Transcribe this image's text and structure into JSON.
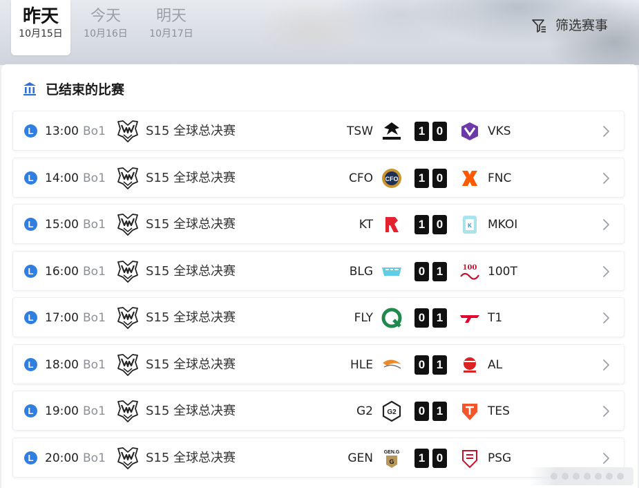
{
  "date_tabs": [
    {
      "day": "昨天",
      "date": "10月15日"
    },
    {
      "day": "今天",
      "date": "10月16日"
    },
    {
      "day": "明天",
      "date": "10月17日"
    }
  ],
  "filter": {
    "label": "筛选赛事"
  },
  "section": {
    "title": "已结束的比赛"
  },
  "colors": {
    "accent": "#2f7ee0",
    "score_bg": "#111111"
  },
  "matches": [
    {
      "badge": "L",
      "time": "13:00",
      "format": "Bo1",
      "event_icon": "worlds-trophy-icon",
      "event": "S15 全球总决赛",
      "team_a": "TSW",
      "logo_a": "tsw-logo-icon",
      "score_a": "1",
      "score_b": "0",
      "team_b": "VKS",
      "logo_b": "vks-logo-icon"
    },
    {
      "badge": "L",
      "time": "14:00",
      "format": "Bo1",
      "event_icon": "worlds-trophy-icon",
      "event": "S15 全球总决赛",
      "team_a": "CFO",
      "logo_a": "cfo-logo-icon",
      "score_a": "1",
      "score_b": "0",
      "team_b": "FNC",
      "logo_b": "fnc-logo-icon"
    },
    {
      "badge": "L",
      "time": "15:00",
      "format": "Bo1",
      "event_icon": "worlds-trophy-icon",
      "event": "S15 全球总决赛",
      "team_a": "KT",
      "logo_a": "kt-logo-icon",
      "score_a": "1",
      "score_b": "0",
      "team_b": "MKOI",
      "logo_b": "mkoi-logo-icon"
    },
    {
      "badge": "L",
      "time": "16:00",
      "format": "Bo1",
      "event_icon": "worlds-trophy-icon",
      "event": "S15 全球总决赛",
      "team_a": "BLG",
      "logo_a": "blg-logo-icon",
      "score_a": "0",
      "score_b": "1",
      "team_b": "100T",
      "logo_b": "100t-logo-icon"
    },
    {
      "badge": "L",
      "time": "17:00",
      "format": "Bo1",
      "event_icon": "worlds-trophy-icon",
      "event": "S15 全球总决赛",
      "team_a": "FLY",
      "logo_a": "fly-logo-icon",
      "score_a": "0",
      "score_b": "1",
      "team_b": "T1",
      "logo_b": "t1-logo-icon"
    },
    {
      "badge": "L",
      "time": "18:00",
      "format": "Bo1",
      "event_icon": "worlds-trophy-icon",
      "event": "S15 全球总决赛",
      "team_a": "HLE",
      "logo_a": "hle-logo-icon",
      "score_a": "0",
      "score_b": "1",
      "team_b": "AL",
      "logo_b": "al-logo-icon"
    },
    {
      "badge": "L",
      "time": "19:00",
      "format": "Bo1",
      "event_icon": "worlds-trophy-icon",
      "event": "S15 全球总决赛",
      "team_a": "G2",
      "logo_a": "g2-logo-icon",
      "score_a": "0",
      "score_b": "1",
      "team_b": "TES",
      "logo_b": "tes-logo-icon"
    },
    {
      "badge": "L",
      "time": "20:00",
      "format": "Bo1",
      "event_icon": "worlds-trophy-icon",
      "event": "S15 全球总决赛",
      "team_a": "GEN",
      "logo_a": "gen-logo-icon",
      "score_a": "1",
      "score_b": "0",
      "team_b": "PSG",
      "logo_b": "psg-logo-icon"
    }
  ]
}
